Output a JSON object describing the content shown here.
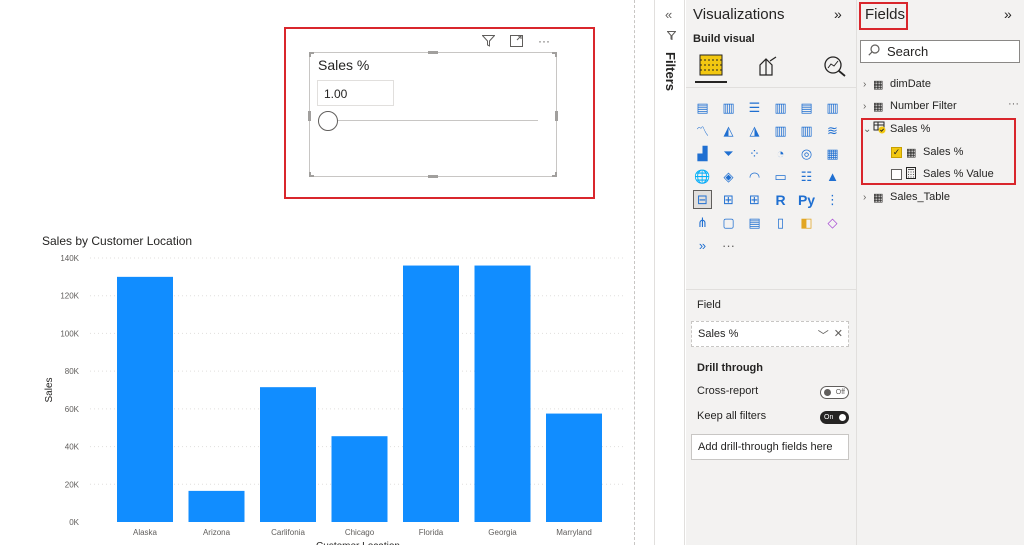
{
  "slicer": {
    "title": "Sales %",
    "value": "1.00",
    "slider_value": 0,
    "toolbar": {
      "filter_icon": "filter-icon",
      "focus_icon": "focus-mode-icon",
      "more_icon": "more-options-icon"
    }
  },
  "chart_data": {
    "type": "bar",
    "title": "Sales by Customer Location",
    "xlabel": "Customer Location",
    "ylabel": "Sales",
    "categories": [
      "Alaska",
      "Arizona",
      "Carlifonia",
      "Chicago",
      "Florida",
      "Georgia",
      "Marryland"
    ],
    "values": [
      130000,
      16500,
      71500,
      45500,
      136000,
      136000,
      57500
    ],
    "ylim": [
      0,
      140000
    ],
    "yticks": [
      0,
      20000,
      40000,
      60000,
      80000,
      100000,
      120000,
      140000
    ],
    "ytick_labels": [
      "0K",
      "20K",
      "40K",
      "60K",
      "80K",
      "100K",
      "120K",
      "140K"
    ],
    "grid": true,
    "bar_color": "#118dff"
  },
  "filters": {
    "label": "Filters",
    "collapse_icon": "double-chevron-left-icon",
    "funnel_icon": "filter-icon"
  },
  "visualizations": {
    "title": "Visualizations",
    "expand_icon": "double-chevron-right-icon",
    "build_label": "Build visual",
    "modes": [
      "build-visual-icon",
      "format-visual-icon",
      "analytics-icon"
    ],
    "icon_grid": [
      "stacked-bar-chart",
      "stacked-column-chart",
      "clustered-bar-chart",
      "clustered-column-chart",
      "100-stacked-bar-chart",
      "100-stacked-column-chart",
      "line-chart",
      "area-chart",
      "stacked-area-chart",
      "line-clustered-column-chart",
      "line-stacked-column-chart",
      "ribbon-chart",
      "waterfall-chart",
      "funnel-chart",
      "scatter-chart",
      "pie-chart",
      "donut-chart",
      "treemap",
      "map",
      "filled-map",
      "gauge",
      "card",
      "multi-row-card",
      "kpi",
      "slicer",
      "table",
      "matrix",
      "r-visual",
      "python-visual",
      "key-influencers",
      "decomposition-tree",
      "qa-visual",
      "smart-narrative",
      "paginated-report",
      "power-apps",
      "power-automate",
      "more-visuals"
    ],
    "field_label": "Field",
    "field_value": "Sales %",
    "drill_title": "Drill through",
    "cross_report_label": "Cross-report",
    "cross_report_state": "Off",
    "keep_filters_label": "Keep all filters",
    "keep_filters_state": "On",
    "add_drill_label": "Add drill-through fields here"
  },
  "fields": {
    "title": "Fields",
    "expand_icon": "double-chevron-right-icon",
    "search_placeholder": "Search",
    "tables": [
      {
        "name": "dimDate",
        "expanded": false
      },
      {
        "name": "Number Filter",
        "expanded": false
      },
      {
        "name": "Sales %",
        "expanded": true,
        "children": [
          {
            "name": "Sales %",
            "checked": true
          },
          {
            "name": "Sales % Value",
            "checked": false
          }
        ]
      },
      {
        "name": "Sales_Table",
        "expanded": false
      }
    ],
    "highlight_color": "#d9262c"
  }
}
